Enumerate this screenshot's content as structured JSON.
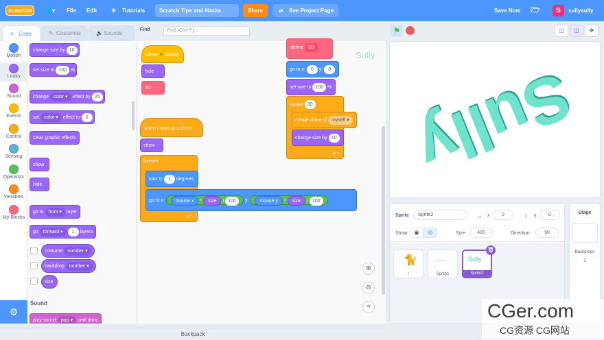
{
  "menu": {
    "logo": "SCRATCH",
    "file": "File",
    "edit": "Edit",
    "tutorials": "Tutorials",
    "project_title": "Scratch Tips and Hacks",
    "share": "Share",
    "see_project_page": "See Project Page",
    "save_now": "Save Now",
    "username": "sullysully"
  },
  "tabs": {
    "code": "Code",
    "costumes": "Costumes",
    "sounds": "Sounds"
  },
  "find": {
    "label": "Find",
    "placeholder": "Find (Ctrl+F)"
  },
  "categories": [
    {
      "label": "Motion",
      "color": "#4c97ff"
    },
    {
      "label": "Looks",
      "color": "#9966ff"
    },
    {
      "label": "Sound",
      "color": "#cf63cf"
    },
    {
      "label": "Events",
      "color": "#ffbf00"
    },
    {
      "label": "Control",
      "color": "#ffab19"
    },
    {
      "label": "Sensing",
      "color": "#5cb1d6"
    },
    {
      "label": "Operators",
      "color": "#59c059"
    },
    {
      "label": "Variables",
      "color": "#ff8c1a"
    },
    {
      "label": "My Blocks",
      "color": "#ff6680"
    }
  ],
  "palette": {
    "change_size_by": "change size by",
    "change_size_val": "10",
    "set_size_to": "set size to",
    "set_size_val": "100",
    "pct": "%",
    "change": "change",
    "color": "color",
    "effect_by": "effect by",
    "effect_val": "25",
    "set": "set",
    "effect_to": "effect to",
    "set_effect_val": "0",
    "clear_effects": "clear graphic effects",
    "show": "show",
    "hide": "hide",
    "go_to": "go to",
    "front": "front",
    "layer": "layer",
    "go": "go",
    "forward": "forward",
    "layers_val": "1",
    "layers": "layers",
    "costume": "costume",
    "number": "number",
    "backdrop": "backdrop",
    "size": "size",
    "sound_header": "Sound",
    "play_sound": "play sound",
    "pop": "pop",
    "until_done": "until done"
  },
  "scripts": {
    "when": "when",
    "clicked": "clicked",
    "hide": "hide",
    "define_3d_call": "3D",
    "when_clone": "when I start as a clone",
    "show": "show",
    "forever": "forever",
    "turn": "turn",
    "turn_val": "1",
    "degrees": "degrees",
    "go_to_x": "go to x:",
    "mouse_x": "mouse x",
    "times": "*",
    "size": "size",
    "div": "/",
    "hundred": "100",
    "y": "y:",
    "mouse_y": "mouse y",
    "define": "define",
    "define_name": "3D",
    "go_to_x0": "go to x:",
    "x0": "0",
    "y_label": "y:",
    "y0": "0",
    "set_size_to": "set size to",
    "set_size_val": "100",
    "pct": "%",
    "repeat": "repeat",
    "repeat_val": "30",
    "create_clone_of": "create clone of",
    "myself": "myself",
    "change_size_by": "change size by",
    "change_size_val": "10",
    "watermark": "Sully"
  },
  "sprite": {
    "sprite_label": "Sprite",
    "name": "Sprite2",
    "x_label": "x",
    "x": "0",
    "y_label": "y",
    "y": "0",
    "show_label": "Show",
    "size_label": "Size",
    "size": "400",
    "direction_label": "Direction",
    "direction": "90"
  },
  "sprites": [
    {
      "name": "/"
    },
    {
      "name": "Sprite1"
    },
    {
      "name": "Sprite2",
      "thumb": "Sully"
    }
  ],
  "stage_panel": {
    "title": "Stage",
    "backdrops_label": "Backdrops",
    "backdrops_count": "1"
  },
  "stage_art_text": "Sully",
  "backpack": "Backpack",
  "watermark_site": {
    "line1": "CGer.com",
    "line2": "CG资源 CG网站"
  }
}
